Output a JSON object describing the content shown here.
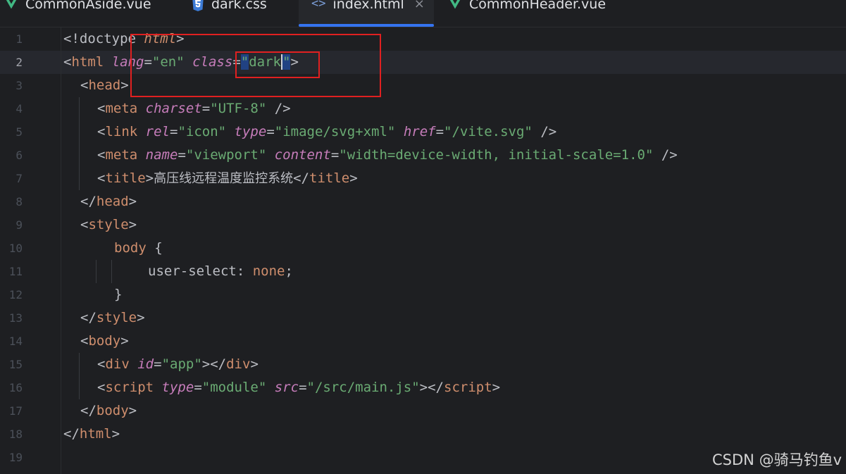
{
  "tabs": [
    {
      "label": "CommonAside.vue",
      "icon": "vue-icon",
      "active": false
    },
    {
      "label": "dark.css",
      "icon": "css-icon",
      "active": false
    },
    {
      "label": "index.html",
      "icon": "html-icon",
      "active": true,
      "close": "×"
    },
    {
      "label": "CommonHeader.vue",
      "icon": "vue-icon",
      "active": false
    }
  ],
  "html_icon_glyph": "<>",
  "line_numbers": [
    "1",
    "2",
    "3",
    "4",
    "5",
    "6",
    "7",
    "8",
    "9",
    "10",
    "11",
    "12",
    "13",
    "14",
    "15",
    "16",
    "17",
    "18",
    "19"
  ],
  "code": {
    "l1": {
      "open": "<!doctype ",
      "kw": "html",
      "close": ">"
    },
    "l2": {
      "lt": "<",
      "tag": "html",
      "a1": "lang",
      "eq1": "=",
      "v1": "\"en\"",
      "a2": "class",
      "eq2": "=",
      "q1": "\"",
      "v2": "dark",
      "q2": "\"",
      "gt": ">"
    },
    "l3": {
      "lt": "<",
      "tag": "head",
      "gt": ">"
    },
    "l4": {
      "lt": "<",
      "tag": "meta",
      "a1": "charset",
      "eq": "=",
      "v1": "\"UTF-8\"",
      "end": " />"
    },
    "l5": {
      "lt": "<",
      "tag": "link",
      "a1": "rel",
      "v1": "\"icon\"",
      "a2": "type",
      "v2": "\"image/svg+xml\"",
      "a3": "href",
      "v3": "\"/vite.svg\"",
      "end": " />"
    },
    "l6": {
      "lt": "<",
      "tag": "meta",
      "a1": "name",
      "v1": "\"viewport\"",
      "a2": "content",
      "v2": "\"width=device-width, initial-scale=1.0\"",
      "end": " />"
    },
    "l7": {
      "lt": "<",
      "tag": "title",
      "gt": ">",
      "text": "高压线远程温度监控系统",
      "clt": "</",
      "ctag": "title",
      "cgt": ">"
    },
    "l8": {
      "lt": "</",
      "tag": "head",
      "gt": ">"
    },
    "l9": {
      "lt": "<",
      "tag": "style",
      "gt": ">"
    },
    "l10": {
      "sel": "body",
      "brace": " {"
    },
    "l11": {
      "prop": "user-select",
      "colon": ": ",
      "val": "none",
      "semi": ";"
    },
    "l12": {
      "brace": "}"
    },
    "l13": {
      "lt": "</",
      "tag": "style",
      "gt": ">"
    },
    "l14": {
      "lt": "<",
      "tag": "body",
      "gt": ">"
    },
    "l15": {
      "lt": "<",
      "tag": "div",
      "a1": "id",
      "v1": "\"app\"",
      "mid": "></",
      "ctag": "div",
      "gt": ">"
    },
    "l16": {
      "lt": "<",
      "tag": "script",
      "a1": "type",
      "v1": "\"module\"",
      "a2": "src",
      "v2": "\"/src/main.js\"",
      "mid": "></",
      "ctag": "script",
      "gt": ">"
    },
    "l17": {
      "lt": "</",
      "tag": "body",
      "gt": ">"
    },
    "l18": {
      "lt": "</",
      "tag": "html",
      "gt": ">"
    }
  },
  "colors": {
    "background": "#1e1f22",
    "tab_underline": "#3574f0",
    "tag": "#cf8e6d",
    "string": "#6aab73",
    "attribute": "#c77dbb",
    "annotation_box": "#e02020"
  },
  "watermark": "CSDN @骑马钓鱼v"
}
